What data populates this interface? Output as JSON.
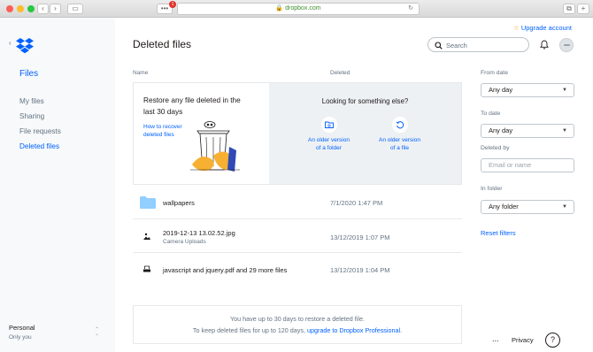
{
  "browser": {
    "url": "dropbox.com",
    "tab_count_badge": "1"
  },
  "header": {
    "upgrade_label": "Upgrade account",
    "page_title": "Deleted files",
    "search_placeholder": "Search"
  },
  "sidebar": {
    "title": "Files",
    "items": [
      {
        "label": "My files"
      },
      {
        "label": "Sharing"
      },
      {
        "label": "File requests"
      },
      {
        "label": "Deleted files"
      }
    ],
    "account": {
      "name": "Personal",
      "sub": "Only you"
    }
  },
  "table": {
    "col_name": "Name",
    "col_deleted": "Deleted",
    "rows": [
      {
        "name": "wallpapers",
        "sub": "",
        "date": "7/1/2020 1:47 PM",
        "icon": "folder-icon"
      },
      {
        "name": "2019-12-13 13.02.52.jpg",
        "sub": "Camera Uploads",
        "date": "13/12/2019 1:07 PM",
        "icon": "image-file-icon"
      },
      {
        "name": "javascript and jquery.pdf and 29 more files",
        "sub": "",
        "date": "13/12/2019 1:04 PM",
        "icon": "file-stack-icon"
      }
    ]
  },
  "promo": {
    "heading": "Restore any file deleted in the last 30 days",
    "heading_line1": "Restore any file deleted in the",
    "heading_line2": "last 30 days",
    "link_line1": "How to recover",
    "link_line2": "deleted files",
    "looking_title": "Looking for something else?",
    "folder_version_line1": "An older version",
    "folder_version_line2": "of a folder",
    "file_version_line1": "An older version",
    "file_version_line2": "of a file"
  },
  "footer_notice": {
    "line1": "You have up to 30 days to restore a deleted file.",
    "line2_prefix": "To keep deleted files for up to 120 days, ",
    "line2_link": "upgrade to Dropbox Professional",
    "line2_suffix": "."
  },
  "filters": {
    "from_label": "From date",
    "from_value": "Any day",
    "to_label": "To date",
    "to_value": "Any day",
    "deleted_by_label": "Deleted by",
    "deleted_by_placeholder": "Email or name",
    "in_folder_label": "In folder",
    "in_folder_value": "Any folder",
    "reset_label": "Reset filters"
  },
  "bottom_bar": {
    "more": "...",
    "privacy": "Privacy",
    "help": "?"
  },
  "colors": {
    "accent": "#0061fe",
    "sidebar_bg": "#f7f9fa",
    "promo_right_bg": "#eef1f4",
    "upgrade": "#0061fe"
  }
}
